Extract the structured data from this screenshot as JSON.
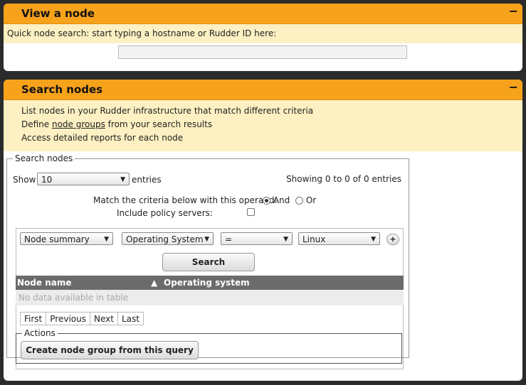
{
  "view_panel": {
    "title": "View a node",
    "collapse_icon": "−",
    "quick_search_text": "Quick node search: start typing a hostname or Rudder ID here:",
    "quick_search_value": ""
  },
  "search_panel": {
    "title": "Search nodes",
    "collapse_icon": "−",
    "info_line1": "List nodes in your Rudder infrastructure that match different criteria",
    "info_line2_prefix": "Define ",
    "info_line2_link": "node groups",
    "info_line2_suffix": " from your search results",
    "info_line3": "Access detailed reports for each node"
  },
  "search_box": {
    "legend": "Search nodes",
    "show_label": "Show",
    "page_size": "10",
    "entries_label": "entries",
    "showing_text": "Showing 0 to 0 of 0 entries",
    "operand_label": "Match the criteria below with this operand:",
    "and_label": "And",
    "or_label": "Or",
    "operand_selected": "And",
    "include_policy_label": "Include policy servers:",
    "include_policy_checked": false,
    "criteria": {
      "object": "Node summary",
      "attribute": "Operating System",
      "comparator": "=",
      "value": "Linux",
      "add_label": "+"
    },
    "search_button": "Search",
    "table": {
      "columns": [
        "Node name",
        "Operating system"
      ],
      "sort_icon": "▲",
      "empty_text": "No data available in table"
    },
    "pager": [
      "First",
      "Previous",
      "Next",
      "Last"
    ],
    "actions_legend": "Actions",
    "create_group_button": "Create node group from this query"
  }
}
